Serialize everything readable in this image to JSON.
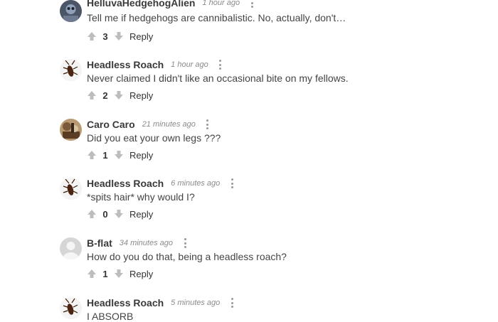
{
  "comments": [
    {
      "author": "HelluvaHedgehogAlien",
      "time": "1 hour ago",
      "text": "Tell me if hedgehogs are cannibalistic. No, actually, don't…",
      "score": "3",
      "reply": "Reply",
      "avatar_icon": "alien-avatar"
    },
    {
      "author": "Headless Roach",
      "time": "1 hour ago",
      "text": "Never claimed I didn't like an occasional bite on my fellows.",
      "score": "2",
      "reply": "Reply",
      "avatar_icon": "cockroach-avatar"
    },
    {
      "author": "Caro Caro",
      "time": "21 minutes ago",
      "text": "Did you eat your own legs ???",
      "score": "1",
      "reply": "Reply",
      "avatar_icon": "photo-avatar"
    },
    {
      "author": "Headless Roach",
      "time": "6 minutes ago",
      "text": "*spits hair* why would I?",
      "score": "0",
      "reply": "Reply",
      "avatar_icon": "cockroach-avatar"
    },
    {
      "author": "B-flat",
      "time": "34 minutes ago",
      "text": "How do you do that, being a headless roach?",
      "score": "1",
      "reply": "Reply",
      "avatar_icon": "default-avatar"
    },
    {
      "author": "Headless Roach",
      "time": "5 minutes ago",
      "text": "I ABSORB",
      "score": "",
      "reply": "",
      "avatar_icon": "cockroach-avatar"
    }
  ],
  "colors": {
    "vote_icon": "#bdbdbd",
    "text": "#444444",
    "muted": "#8a8a8a"
  }
}
